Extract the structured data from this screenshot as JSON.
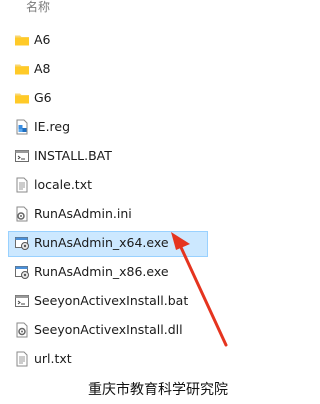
{
  "column_header": "名称",
  "files": [
    {
      "name": "A6",
      "icon": "folder-icon"
    },
    {
      "name": "A8",
      "icon": "folder-icon"
    },
    {
      "name": "G6",
      "icon": "folder-icon"
    },
    {
      "name": "IE.reg",
      "icon": "registry-file-icon"
    },
    {
      "name": "INSTALL.BAT",
      "icon": "batch-file-icon"
    },
    {
      "name": "locale.txt",
      "icon": "text-file-icon"
    },
    {
      "name": "RunAsAdmin.ini",
      "icon": "config-file-icon"
    },
    {
      "name": "RunAsAdmin_x64.exe",
      "icon": "executable-icon",
      "selected": true
    },
    {
      "name": "RunAsAdmin_x86.exe",
      "icon": "executable-icon"
    },
    {
      "name": "SeeyonActivexInstall.bat",
      "icon": "batch-file-icon"
    },
    {
      "name": "SeeyonActivexInstall.dll",
      "icon": "dll-file-icon"
    },
    {
      "name": "url.txt",
      "icon": "text-file-icon"
    }
  ],
  "watermark": "重庆市教育科学研究院",
  "colors": {
    "selection_bg": "#cce8ff",
    "selection_border": "#99d1ff",
    "folder": "#f8d775",
    "arrow": "#e5341f"
  }
}
